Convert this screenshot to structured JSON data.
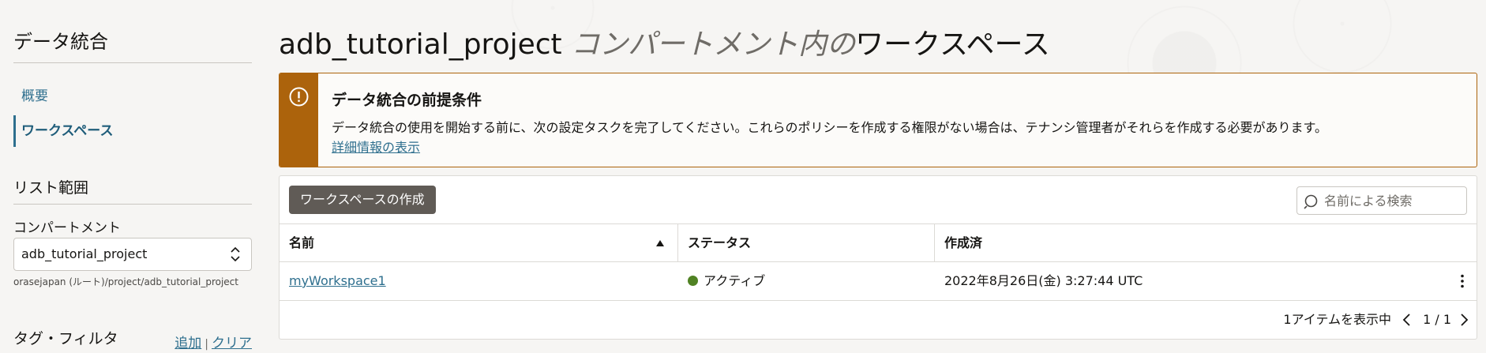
{
  "sidebar": {
    "title": "データ統合",
    "nav": [
      {
        "label": "概要",
        "active": false
      },
      {
        "label": "ワークスペース",
        "active": true
      }
    ],
    "list_scope": {
      "title": "リスト範囲",
      "compartment_label": "コンパートメント",
      "compartment_value": "adb_tutorial_project",
      "compartment_path": "orasejapan (ルート)/project/adb_tutorial_project"
    },
    "tag_filter": {
      "title": "タグ・フィルタ",
      "add_label": "追加",
      "separator": "|",
      "clear_label": "クリア"
    }
  },
  "main": {
    "title_project": "adb_tutorial_project",
    "title_mid": " コンパートメント内の",
    "title_tail": "ワークスペース",
    "alert": {
      "icon": "exclamation-circle-icon",
      "title": "データ統合の前提条件",
      "body": "データ統合の使用を開始する前に、次の設定タスクを完了してください。これらのポリシーを作成する権限がない場合は、テナンシ管理者がそれらを作成する必要があります。",
      "link": "詳細情報の表示",
      "color": "#ac630c"
    },
    "toolbar": {
      "create_label": "ワークスペースの作成",
      "search_placeholder": "名前による検索"
    },
    "table": {
      "columns": [
        "名前",
        "ステータス",
        "作成済"
      ],
      "sort_column": "名前",
      "sort_direction": "ascending",
      "rows": [
        {
          "name": "myWorkspace1",
          "status": "アクティブ",
          "status_color": "#508223",
          "created": "2022年8月26日(金) 3:27:44 UTC"
        }
      ]
    },
    "footer": {
      "count_text": "1アイテムを表示中",
      "page": "1 / 1"
    }
  }
}
